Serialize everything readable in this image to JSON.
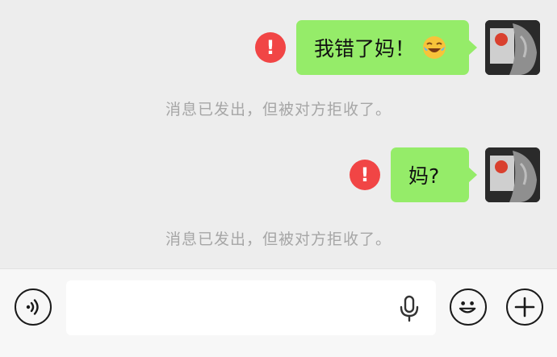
{
  "messages": [
    {
      "text": "我错了妈！",
      "emoji": "crying-laughing-emoji",
      "status": "!"
    },
    {
      "text": "妈?",
      "status": "!"
    }
  ],
  "system_notices": [
    "消息已发出，但被对方拒收了。",
    "消息已发出，但被对方拒收了。"
  ],
  "input": {
    "value": "",
    "placeholder": ""
  },
  "colors": {
    "bubble": "#95ec69",
    "error": "#f14545",
    "notice": "#a6a6a6",
    "background": "#ededed"
  },
  "icons": {
    "voice": "voice-icon",
    "mic": "microphone-icon",
    "emoji": "emoji-icon",
    "plus": "plus-icon"
  }
}
